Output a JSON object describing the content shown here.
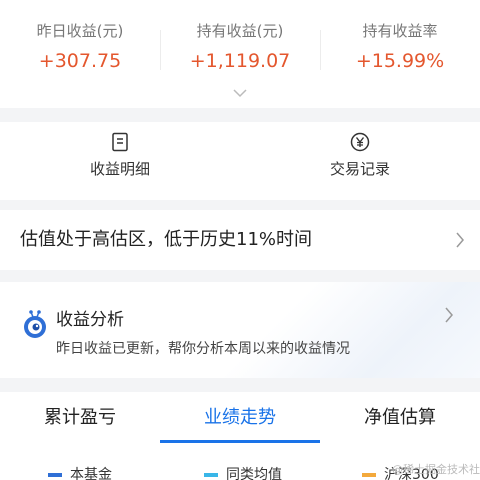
{
  "stats": [
    {
      "label": "昨日收益(元)",
      "value": "+307.75"
    },
    {
      "label": "持有收益(元)",
      "value": "+1,119.07"
    },
    {
      "label": "持有收益率",
      "value": "+15.99%"
    }
  ],
  "shortcuts": {
    "income_detail": "收益明细",
    "trade_records": "交易记录"
  },
  "valuation": {
    "text": "估值处于高估区，低于历史11%时间"
  },
  "analysis": {
    "title": "收益分析",
    "subtitle": "昨日收益已更新，帮你分析本周以来的收益情况"
  },
  "tabs": [
    {
      "label": "累计盈亏"
    },
    {
      "label": "业绩走势"
    },
    {
      "label": "净值估算"
    }
  ],
  "legend": {
    "fund": "本基金",
    "peer": "同类均值",
    "index": "沪深300"
  },
  "watermark": "@稀土掘金技术社区",
  "colors": {
    "gain": "#e4572e",
    "accent": "#1a73e8",
    "legend_fund": "#2f6fd6",
    "legend_peer": "#39b6e8",
    "legend_index": "#f3a93c"
  }
}
